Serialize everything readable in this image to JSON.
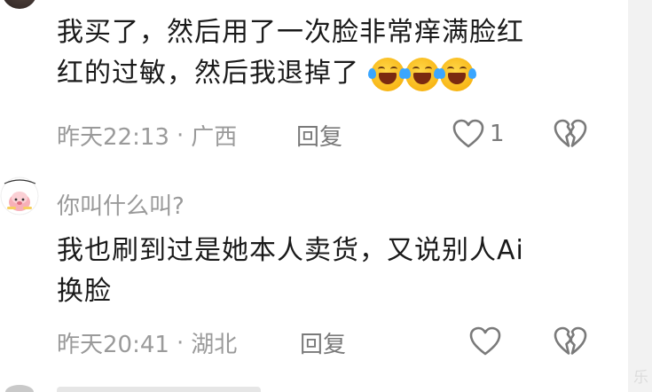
{
  "comments": [
    {
      "text_line1": "我买了，然后用了一次脸非常痒满脸红",
      "text_line2": "红的过敏，然后我退掉了",
      "emoji_icons": [
        "face-with-tears-of-joy-icon",
        "face-with-tears-of-joy-icon",
        "face-with-tears-of-joy-icon"
      ],
      "time": "昨天22:13",
      "location": "广西",
      "reply_label": "回复",
      "like_count": "1"
    },
    {
      "username": "你叫什么叫?",
      "text_line1": "我也刷到过是她本人卖货，又说别人Ai",
      "text_line2": "换脸",
      "time": "昨天20:41",
      "location": "湖北",
      "reply_label": "回复"
    }
  ],
  "meta_separator": "·",
  "colors": {
    "text": "#1a1a1a",
    "meta": "#9a9a9a",
    "icon": "#7a7a7a",
    "emoji": "#f5b800"
  }
}
